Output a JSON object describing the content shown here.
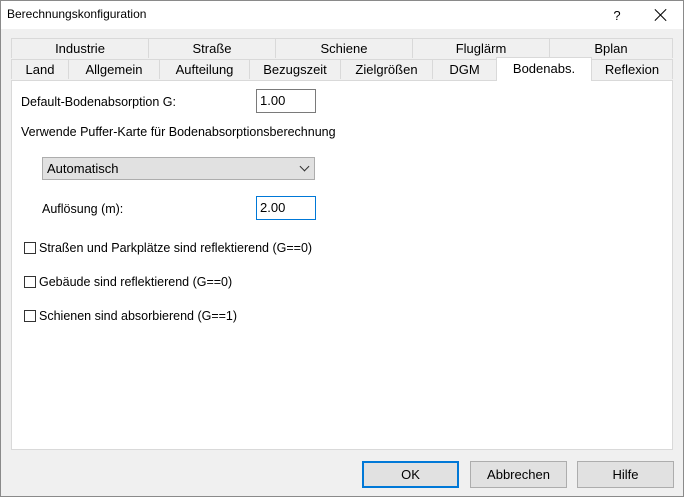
{
  "window": {
    "title": "Berechnungskonfiguration",
    "help_glyph": "?",
    "close_icon": "close-icon"
  },
  "tabs_back": [
    {
      "label": "Industrie"
    },
    {
      "label": "Straße"
    },
    {
      "label": "Schiene"
    },
    {
      "label": "Fluglärm"
    },
    {
      "label": "Bplan"
    }
  ],
  "tabs_front": [
    {
      "label": "Land"
    },
    {
      "label": "Allgemein"
    },
    {
      "label": "Aufteilung"
    },
    {
      "label": "Bezugszeit"
    },
    {
      "label": "Zielgrößen"
    },
    {
      "label": "DGM"
    },
    {
      "label": "Bodenabs.",
      "active": true
    },
    {
      "label": "Reflexion"
    }
  ],
  "form": {
    "default_absorption_label": "Default-Bodenabsorption G:",
    "default_absorption_value": "1.00",
    "buffer_map_label": "Verwende Puffer-Karte für Bodenabsorptionsberechnung",
    "buffer_mode_value": "Automatisch",
    "resolution_label": "Auflösung (m):",
    "resolution_value": "2.00",
    "checkboxes": [
      {
        "label": "Straßen und Parkplätze sind reflektierend (G==0)",
        "checked": false
      },
      {
        "label": "Gebäude sind reflektierend (G==0)",
        "checked": false
      },
      {
        "label": "Schienen sind absorbierend (G==1)",
        "checked": false
      }
    ]
  },
  "buttons": {
    "ok": "OK",
    "cancel": "Abbrechen",
    "help": "Hilfe"
  },
  "colors": {
    "focus": "#0078d7",
    "dialog_bg": "#f0f0f0",
    "panel_bg": "#ffffff"
  }
}
